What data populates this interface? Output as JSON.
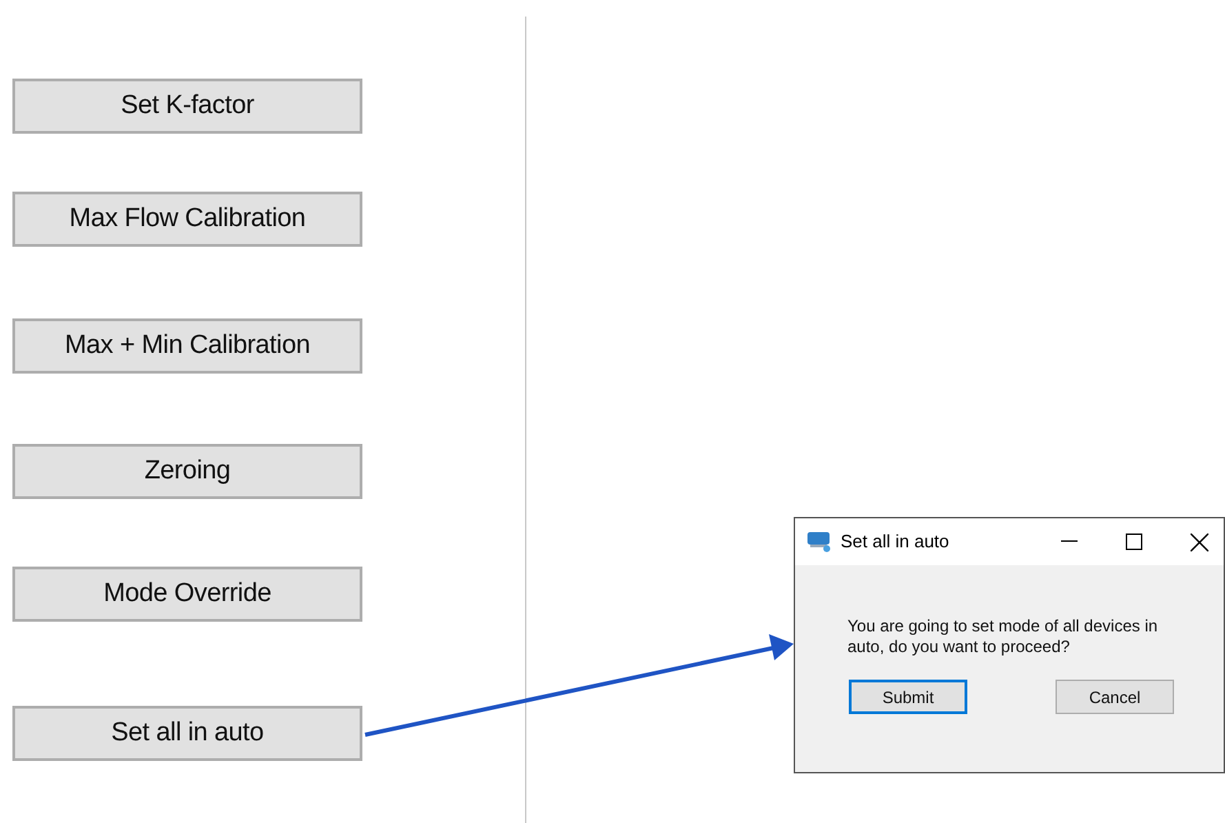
{
  "buttons": [
    {
      "label": "Set K-factor"
    },
    {
      "label": "Max Flow Calibration"
    },
    {
      "label": "Max + Min Calibration"
    },
    {
      "label": "Zeroing"
    },
    {
      "label": "Mode Override"
    },
    {
      "label": "Set all in auto"
    }
  ],
  "dialog": {
    "title": "Set all in auto",
    "message": "You are going to set mode of all devices in auto, do you want to proceed?",
    "buttons": [
      {
        "label": "Submit",
        "focused": true
      },
      {
        "label": "Cancel",
        "focused": false
      }
    ]
  }
}
